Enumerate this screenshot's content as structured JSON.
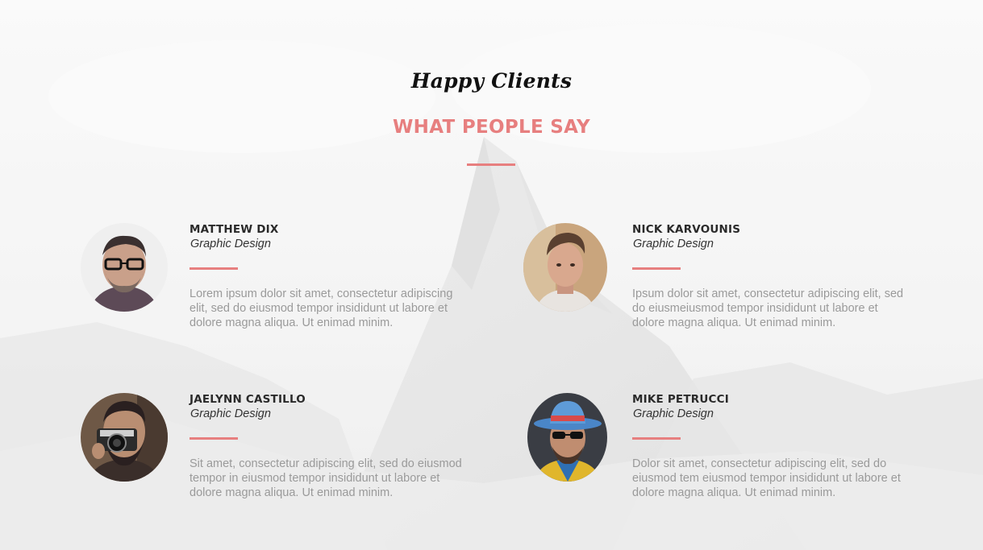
{
  "section": {
    "script_title": "Happy Clients",
    "title": "WHAT PEOPLE SAY"
  },
  "colors": {
    "accent": "#e77f7f",
    "heading_text": "#2a2a2a",
    "body_text": "#9a9a9a"
  },
  "testimonials": [
    {
      "name": "MATTHEW DIX",
      "role": "Graphic Design",
      "quote": "Lorem ipsum dolor sit amet, consectetur adipiscing elit, sed do eiusmod tempor insididunt ut labore et dolore magna aliqua. Ut enimad minim.",
      "avatar_icon": "man-glasses-avatar"
    },
    {
      "name": "NICK KARVOUNIS",
      "role": "Graphic Design",
      "quote": "Ipsum dolor sit amet, consectetur adipiscing elit, sed do eiusmeiusmod tempor insididunt ut labore et dolore magna aliqua. Ut enimad minim.",
      "avatar_icon": "young-man-avatar"
    },
    {
      "name": "JAELYNN CASTILLO",
      "role": "Graphic Design",
      "quote": "Sit amet, consectetur adipiscing elit, sed do eiusmod tempor in eiusmod tempor insididunt ut labore et dolore magna aliqua. Ut enimad minim.",
      "avatar_icon": "photographer-avatar"
    },
    {
      "name": "MIKE PETRUCCI",
      "role": "Graphic Design",
      "quote": "Dolor sit amet, consectetur adipiscing elit, sed do eiusmod tem eiusmod tempor insididunt ut labore et dolore magna aliqua. Ut enimad minim.",
      "avatar_icon": "hat-man-avatar"
    }
  ]
}
